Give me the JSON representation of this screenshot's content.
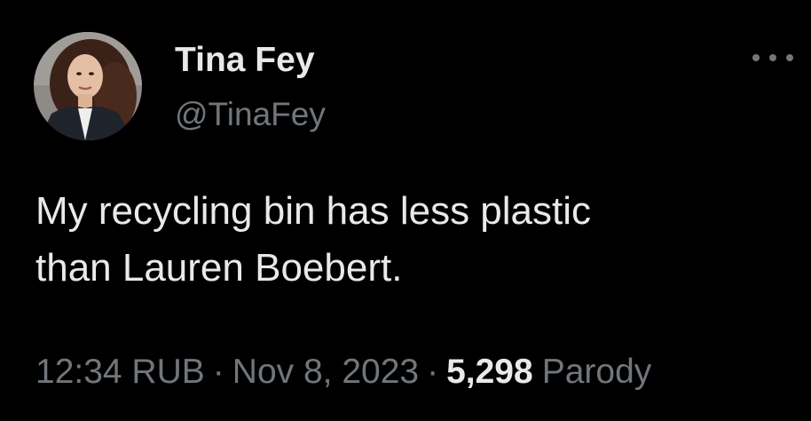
{
  "tweet": {
    "author": {
      "display_name": "Tina Fey",
      "handle": "@TinaFey"
    },
    "text_lines": [
      "My recycling bin has less plastic",
      "than Lauren Boebert."
    ],
    "meta": {
      "time": "12:34 RUB",
      "separator": "·",
      "date": "Nov 8, 2023",
      "count": "5,298",
      "count_label": "Parody"
    }
  },
  "icons": {
    "more": "more-dots-icon",
    "avatar": "profile-photo"
  },
  "colors": {
    "background": "#000000",
    "primary_text": "#e7e9ea",
    "secondary_text": "#71767b"
  }
}
